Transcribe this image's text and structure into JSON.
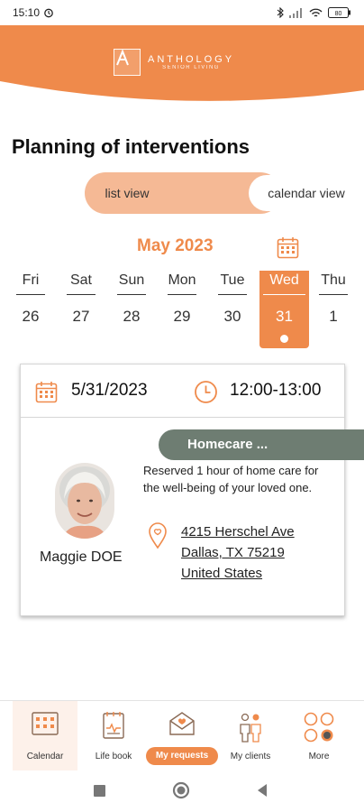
{
  "status_bar": {
    "time": "15:10",
    "battery": "80"
  },
  "brand": {
    "name": "ANTHOLOGY",
    "tagline": "SENIOR LIVING",
    "color": "#ef8a4b"
  },
  "page_title": "Planning of interventions",
  "view_toggle": {
    "list": "list view",
    "calendar": "calendar view",
    "selected": "calendar"
  },
  "calendar": {
    "month": "May 2023",
    "days": [
      {
        "name": "Fri",
        "num": "26"
      },
      {
        "name": "Sat",
        "num": "27"
      },
      {
        "name": "Sun",
        "num": "28"
      },
      {
        "name": "Mon",
        "num": "29"
      },
      {
        "name": "Tue",
        "num": "30"
      },
      {
        "name": "Wed",
        "num": "31"
      },
      {
        "name": "Thu",
        "num": "1"
      }
    ],
    "selected_day": "Wed"
  },
  "appointment": {
    "date": "5/31/2023",
    "time": "12:00-13:00",
    "service": "Homecare ...",
    "description": "Reserved 1 hour of home care for the well-being of your loved one.",
    "client_name": "Maggie DOE",
    "address": {
      "line1": "4215 Herschel Ave",
      "line2": "Dallas, TX 75219",
      "line3": "United States"
    }
  },
  "bottom_nav": {
    "items": [
      {
        "label": "Calendar",
        "icon": "calendar-icon"
      },
      {
        "label": "Life book",
        "icon": "life-book-icon"
      },
      {
        "label": "My requests",
        "icon": "requests-envelope-icon"
      },
      {
        "label": "My clients",
        "icon": "clients-icon"
      },
      {
        "label": "More",
        "icon": "more-circles-icon"
      }
    ]
  }
}
